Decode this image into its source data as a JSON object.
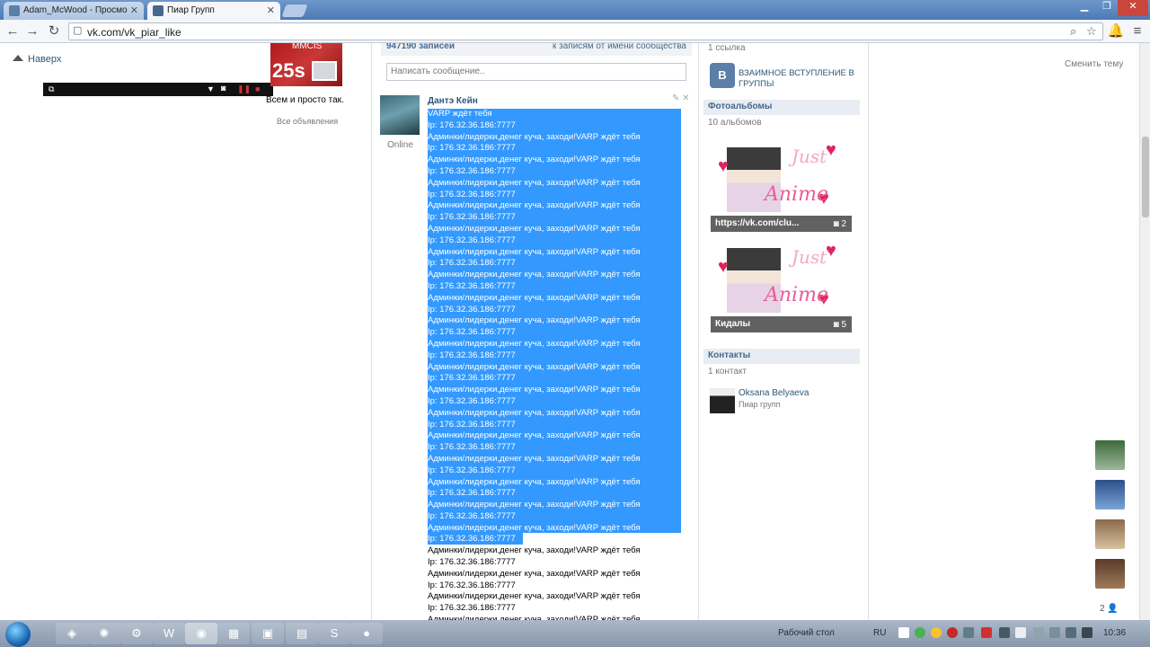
{
  "browser": {
    "tabs": [
      {
        "title": "Adam_McWood - Просмо"
      },
      {
        "title": "Пиар Групп"
      }
    ],
    "url": "vk.com/vk_piar_like"
  },
  "left": {
    "naverh": "Наверх",
    "ad_banner_text": "MMCIS",
    "ad_banner_num": "25s",
    "ad_caption": "Всем и просто так.",
    "ad_all": "Все объявления"
  },
  "wall": {
    "count": "947190 записей",
    "by_community": "к записям от имени сообщества",
    "message_placeholder": "Написать сообщение..",
    "post": {
      "author": "Дантэ Кейн",
      "online": "Online",
      "line_a": "Админки/лидерки,денег куча, заходи!VARP ждёт тебя",
      "line_b": "Ip: 176.32.36.186:7777",
      "first_line": "VARP ждёт тебя"
    }
  },
  "right": {
    "link_count": "1 ссылка",
    "vz_text": "ВЗАИМНОЕ ВСТУПЛЕНИЕ В ГРУППЫ",
    "albums_title": "Фотоальбомы",
    "albums_count": "10 альбомов",
    "albums": [
      {
        "caption": "https://vk.com/clu...",
        "count": "2"
      },
      {
        "caption": "Кидалы",
        "count": "5"
      }
    ],
    "album_art_just": "Just",
    "album_art_anime": "Anime",
    "contacts_title": "Контакты",
    "contacts_count": "1 контакт",
    "contact": {
      "name": "Oksana Belyaeva",
      "role": "Пиар групп"
    }
  },
  "sidebar": {
    "change_theme": "Сменить тему",
    "friends_count": "2"
  },
  "taskbar": {
    "desktop_label": "Рабочий стол",
    "lang": "RU",
    "clock": "10:36"
  },
  "colors": {
    "selection": "#3399ff",
    "vk_link": "#2b587a",
    "vk_header": "#45688e"
  }
}
